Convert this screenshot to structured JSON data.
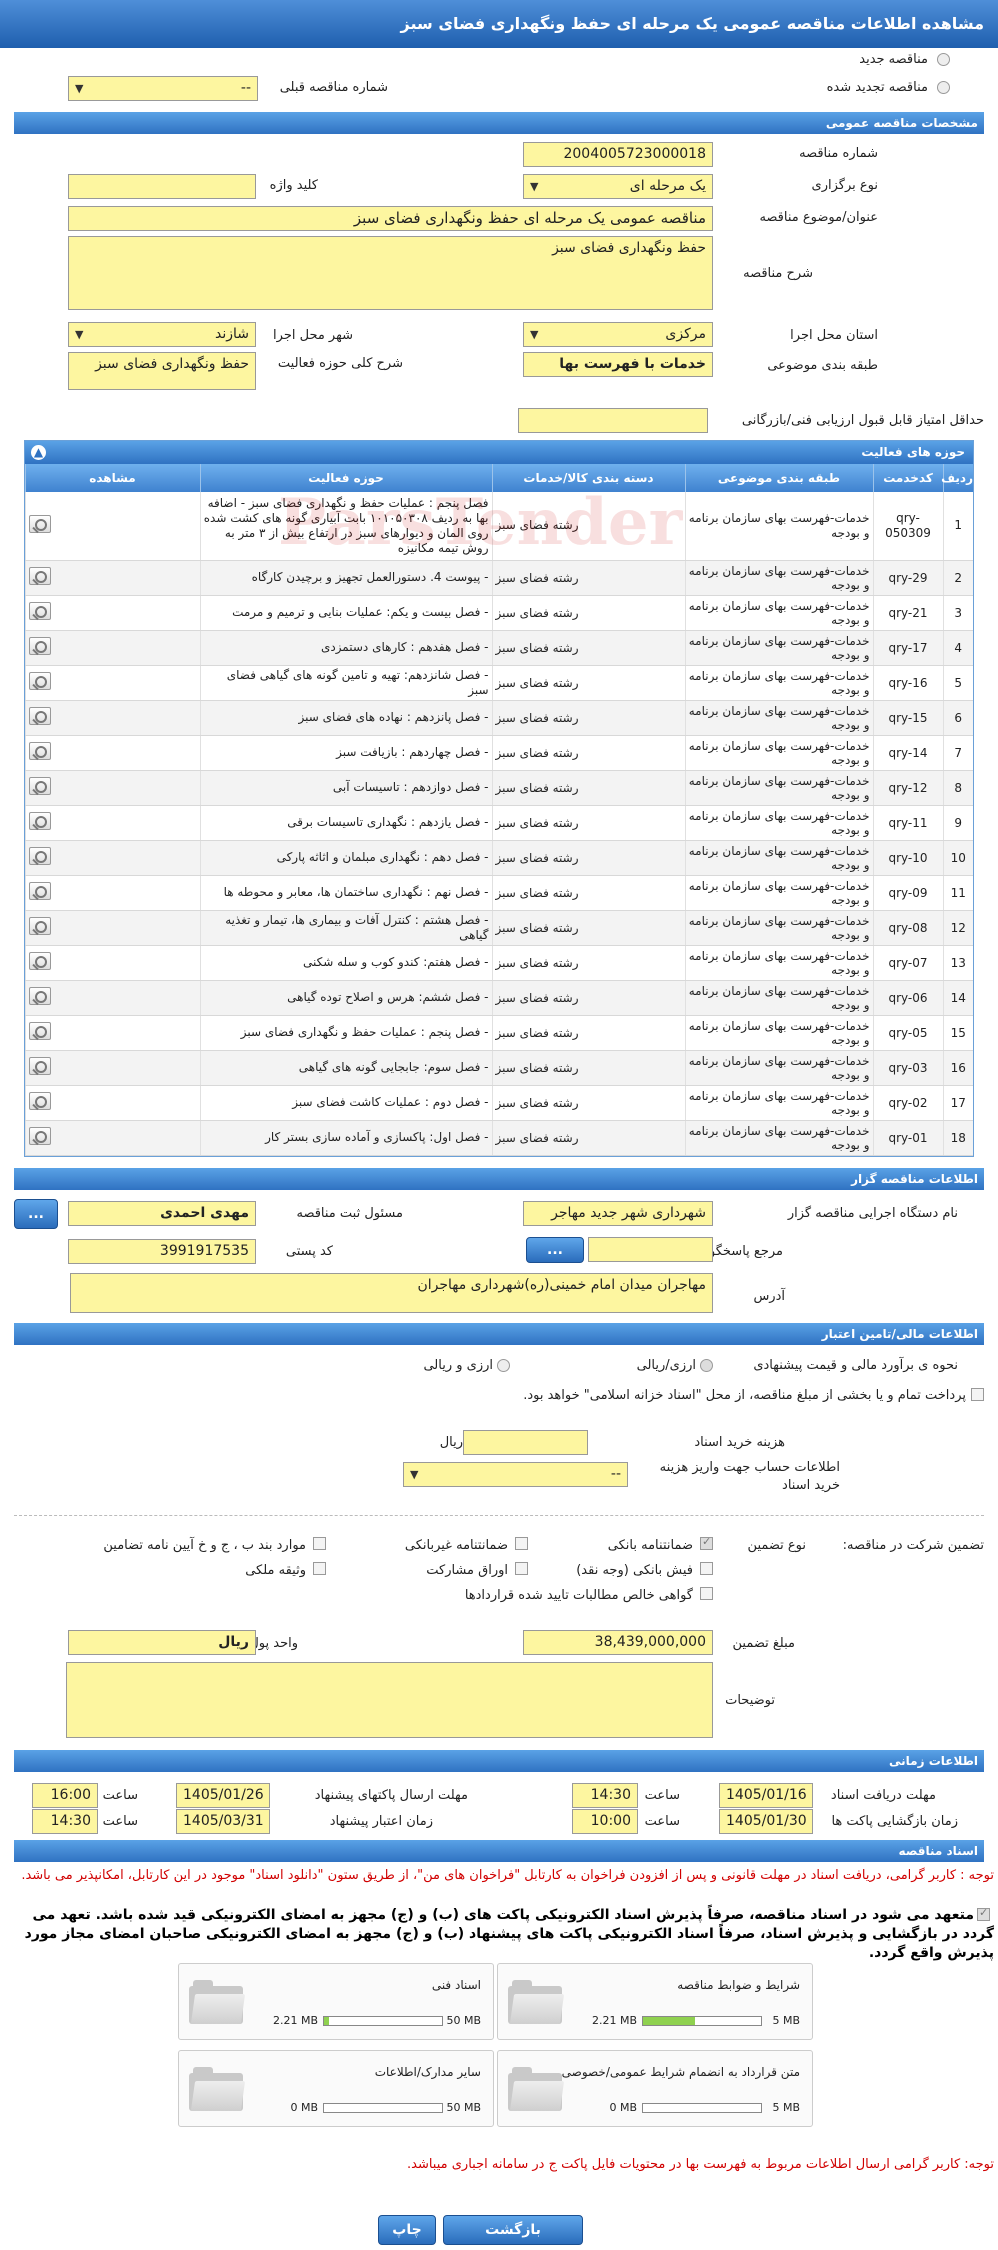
{
  "page_title": "مشاهده اطلاعات مناقصه عمومی یک مرحله ای حفظ ونگهداری فضای سبز",
  "tender_type": {
    "new": "مناقصه جدید",
    "renewed": "مناقصه تجدید شده",
    "prev_number_label": "شماره مناقصه قبلی",
    "prev_number_value": "--"
  },
  "sections": {
    "general": "مشخصات مناقصه عمومی",
    "activity": "حوزه های فعالیت",
    "organizer": "اطلاعات مناقصه گزار",
    "financial": "اطلاعات مالی/تامین اعتبار",
    "timing": "اطلاعات زمانی",
    "docs": "اسناد مناقصه"
  },
  "general": {
    "number_label": "شماره مناقصه",
    "number": "2004005723000018",
    "holding_label": "نوع برگزاری",
    "holding": "یک مرحله ای",
    "keyword_label": "کلید واژه",
    "keyword": "",
    "subject_label": "عنوان/موضوع مناقصه",
    "subject": "مناقصه عمومی یک مرحله ای حفظ ونگهداری فضای سبز",
    "desc_label": "شرح مناقصه",
    "desc": "حفظ ونگهداری فضای سبز",
    "province_label": "استان محل اجرا",
    "province": "مرکزی",
    "city_label": "شهر محل اجرا",
    "city": "شازند",
    "category_label": "طبقه بندی موضوعی",
    "category": "خدمات با فهرست بها",
    "scope_label": "شرح کلی حوزه فعالیت",
    "scope": "حفظ ونگهداری فضای سبز",
    "min_score_label": "حداقل امتیاز قابل قبول ارزیابی فنی/بازرگانی",
    "min_score": ""
  },
  "activity_table": {
    "headers": [
      "ردیف",
      "کدخدمت",
      "طبقه بندی موضوعی",
      "دسته بندی کالا/خدمات",
      "حوزه فعالیت",
      "مشاهده"
    ],
    "rows": [
      [
        "1",
        "qry-050309",
        "خدمات-فهرست بهای سازمان برنامه و بودجه",
        "رشته فضای سبز",
        "فصل پنجم : عملیات حفظ و نگهداری فضای سبز - اضافه بها به ردیف ۱۰۱۰۵۰۳۰۸ بابت آبیاری گونه های کشت شده روی المان و دیوارهای سبز در ارتفاع بیش از ۳ متر به روش تیمه مکانیزه"
      ],
      [
        "2",
        "qry-29",
        "خدمات-فهرست بهای سازمان برنامه و بودجه",
        "رشته فضای سبز",
        "- پیوست 4. دستورالعمل تجهیز و برچیدن کارگاه"
      ],
      [
        "3",
        "qry-21",
        "خدمات-فهرست بهای سازمان برنامه و بودجه",
        "رشته فضای سبز",
        "- فصل بیست و یکم: عملیات بنایی و ترمیم و مرمت"
      ],
      [
        "4",
        "qry-17",
        "خدمات-فهرست بهای سازمان برنامه و بودجه",
        "رشته فضای سبز",
        "- فصل هفدهم : کارهای دستمزدی"
      ],
      [
        "5",
        "qry-16",
        "خدمات-فهرست بهای سازمان برنامه و بودجه",
        "رشته فضای سبز",
        "- فصل شانزدهم: تهیه و تامین گونه های گیاهی فضای سبز"
      ],
      [
        "6",
        "qry-15",
        "خدمات-فهرست بهای سازمان برنامه و بودجه",
        "رشته فضای سبز",
        "- فصل پانزدهم : نهاده های فضای سبز"
      ],
      [
        "7",
        "qry-14",
        "خدمات-فهرست بهای سازمان برنامه و بودجه",
        "رشته فضای سبز",
        "- فصل چهاردهم : بازیافت سبز"
      ],
      [
        "8",
        "qry-12",
        "خدمات-فهرست بهای سازمان برنامه و بودجه",
        "رشته فضای سبز",
        "- فصل دوازدهم : تاسیسات آبی"
      ],
      [
        "9",
        "qry-11",
        "خدمات-فهرست بهای سازمان برنامه و بودجه",
        "رشته فضای سبز",
        "- فصل یازدهم : نگهداری تاسیسات برقی"
      ],
      [
        "10",
        "qry-10",
        "خدمات-فهرست بهای سازمان برنامه و بودجه",
        "رشته فضای سبز",
        "- فصل دهم : نگهداری مبلمان و اثاثه پارکی"
      ],
      [
        "11",
        "qry-09",
        "خدمات-فهرست بهای سازمان برنامه و بودجه",
        "رشته فضای سبز",
        "- فصل نهم : نگهداری ساختمان ها، معابر و محوطه ها"
      ],
      [
        "12",
        "qry-08",
        "خدمات-فهرست بهای سازمان برنامه و بودجه",
        "رشته فضای سبز",
        "- فصل هشتم : کنترل آفات و بیماری ها، تیمار و تغذیه گیاهی"
      ],
      [
        "13",
        "qry-07",
        "خدمات-فهرست بهای سازمان برنامه و بودجه",
        "رشته فضای سبز",
        "- فصل هفتم: کندو کوب و سله شکنی"
      ],
      [
        "14",
        "qry-06",
        "خدمات-فهرست بهای سازمان برنامه و بودجه",
        "رشته فضای سبز",
        "- فصل ششم: هرس و اصلاح توده گیاهی"
      ],
      [
        "15",
        "qry-05",
        "خدمات-فهرست بهای سازمان برنامه و بودجه",
        "رشته فضای سبز",
        "- فصل پنجم : عملیات حفظ و نگهداری فضای سبز"
      ],
      [
        "16",
        "qry-03",
        "خدمات-فهرست بهای سازمان برنامه و بودجه",
        "رشته فضای سبز",
        "- فصل سوم: جابجایی گونه های گیاهی"
      ],
      [
        "17",
        "qry-02",
        "خدمات-فهرست بهای سازمان برنامه و بودجه",
        "رشته فضای سبز",
        "- فصل دوم : عملیات کاشت فضای سبز"
      ],
      [
        "18",
        "qry-01",
        "خدمات-فهرست بهای سازمان برنامه و بودجه",
        "رشته فضای سبز",
        "- فصل اول: پاکسازی و آماده سازی بستر کار"
      ]
    ]
  },
  "watermark": "ParsTender",
  "organizer": {
    "org_label": "نام دستگاه اجرایی مناقصه گزار",
    "org": "شهرداری شهر جدید مهاجر",
    "resp_label": "مسئول ثبت مناقصه",
    "resp": "مهدی احمدی",
    "ref_label": "مرجع پاسخگویی",
    "ref": "",
    "postal_label": "کد پستی",
    "postal": "3991917535",
    "addr_label": "آدرس",
    "addr": "مهاجران میدان امام خمینی(ره)شهرداری مهاجران",
    "dots": "..."
  },
  "financial": {
    "method_label": "نحوه ی برآورد مالی و قیمت پیشنهادی",
    "opt_rial": "ارزی/ریالی",
    "opt_both": "ارزی و ریالی",
    "treasury_text": "پرداخت تمام و یا بخشی از مبلغ مناقصه، از محل \"اسناد خزانه اسلامی\" خواهد بود.",
    "doc_fee_label": "هزینه خرید اسناد",
    "doc_fee": "",
    "rial": "ریال",
    "account_label": "اطلاعات حساب جهت واریز هزینه خرید اسناد",
    "account": "--",
    "guarantee_label": "تضمین شرکت در مناقصه:",
    "guarantee_type_label": "نوع تضمین",
    "g_bank": "ضمانتنامه بانکی",
    "g_nonbank": "ضمانتنامه غیربانکی",
    "g_insurance": "موارد بند ب ، ج و خ آیین نامه تضامین",
    "g_cheque": "فیش بانکی (وجه نقد)",
    "g_bonds": "اوراق مشارکت",
    "g_property": "وثیقه ملکی",
    "g_claims": "گواهی خالص مطالبات تایید شده قراردادها",
    "amount_label": "مبلغ تضمین",
    "amount": "38,439,000,000",
    "currency_label": "واحد پول",
    "currency": "ریال",
    "notes_label": "توضیحات",
    "notes": ""
  },
  "timing": {
    "receive_label": "مهلت دریافت اسناد",
    "receive_date": "1405/01/16",
    "receive_time": "14:30",
    "send_label": "مهلت ارسال پاکتهای پیشنهاد",
    "send_date": "1405/01/26",
    "send_time": "16:00",
    "open_label": "زمان بازگشایی پاکت ها",
    "open_date": "1405/01/30",
    "open_time": "10:00",
    "valid_label": "زمان اعتبار پیشنهاد",
    "valid_date": "1405/03/31",
    "valid_time": "14:30",
    "hour": "ساعت"
  },
  "docs": {
    "note1": "توجه : کاربر گرامی، دریافت اسناد در مهلت قانونی و پس از افزودن فراخوان به کارتابل \"فراخوان های من\"، از طریق ستون \"دانلود اسناد\" موجود در این کارتابل، امکانپذیر می باشد.",
    "commit": "متعهد می شود در اسناد مناقصه، صرفاً پذیرش اسناد الکترونیکی پاکت های (ب) و (ج) مجهز به امضای الکترونیکی قید شده باشد. تعهد می گردد در بازگشایی و پذیرش اسناد، صرفاً اسناد الکترونیکی پاکت های پیشنهاد (ب) و (ج) مجهز به امضای الکترونیکی صاحبان امضای مجاز مورد پذیرش واقع گردد.",
    "boxes": [
      {
        "title": "شرایط و ضوابط مناقصه",
        "size": "2.21 MB",
        "max": "5 MB",
        "fill": 0.44
      },
      {
        "title": "اسناد فنی",
        "size": "2.21 MB",
        "max": "50 MB",
        "fill": 0.044
      },
      {
        "title": "متن قرارداد به انضمام شرایط عمومی/خصوصی",
        "size": "0 MB",
        "max": "5 MB",
        "fill": 0
      },
      {
        "title": "سایر مدارک/اطلاعات",
        "size": "0 MB",
        "max": "50 MB",
        "fill": 0
      }
    ],
    "note2": "توجه: کاربر گرامی ارسال اطلاعات مربوط به فهرست بها در محتویات فایل پاکت ج در سامانه اجباری میباشد."
  },
  "buttons": {
    "print": "چاپ",
    "back": "بازگشت"
  }
}
